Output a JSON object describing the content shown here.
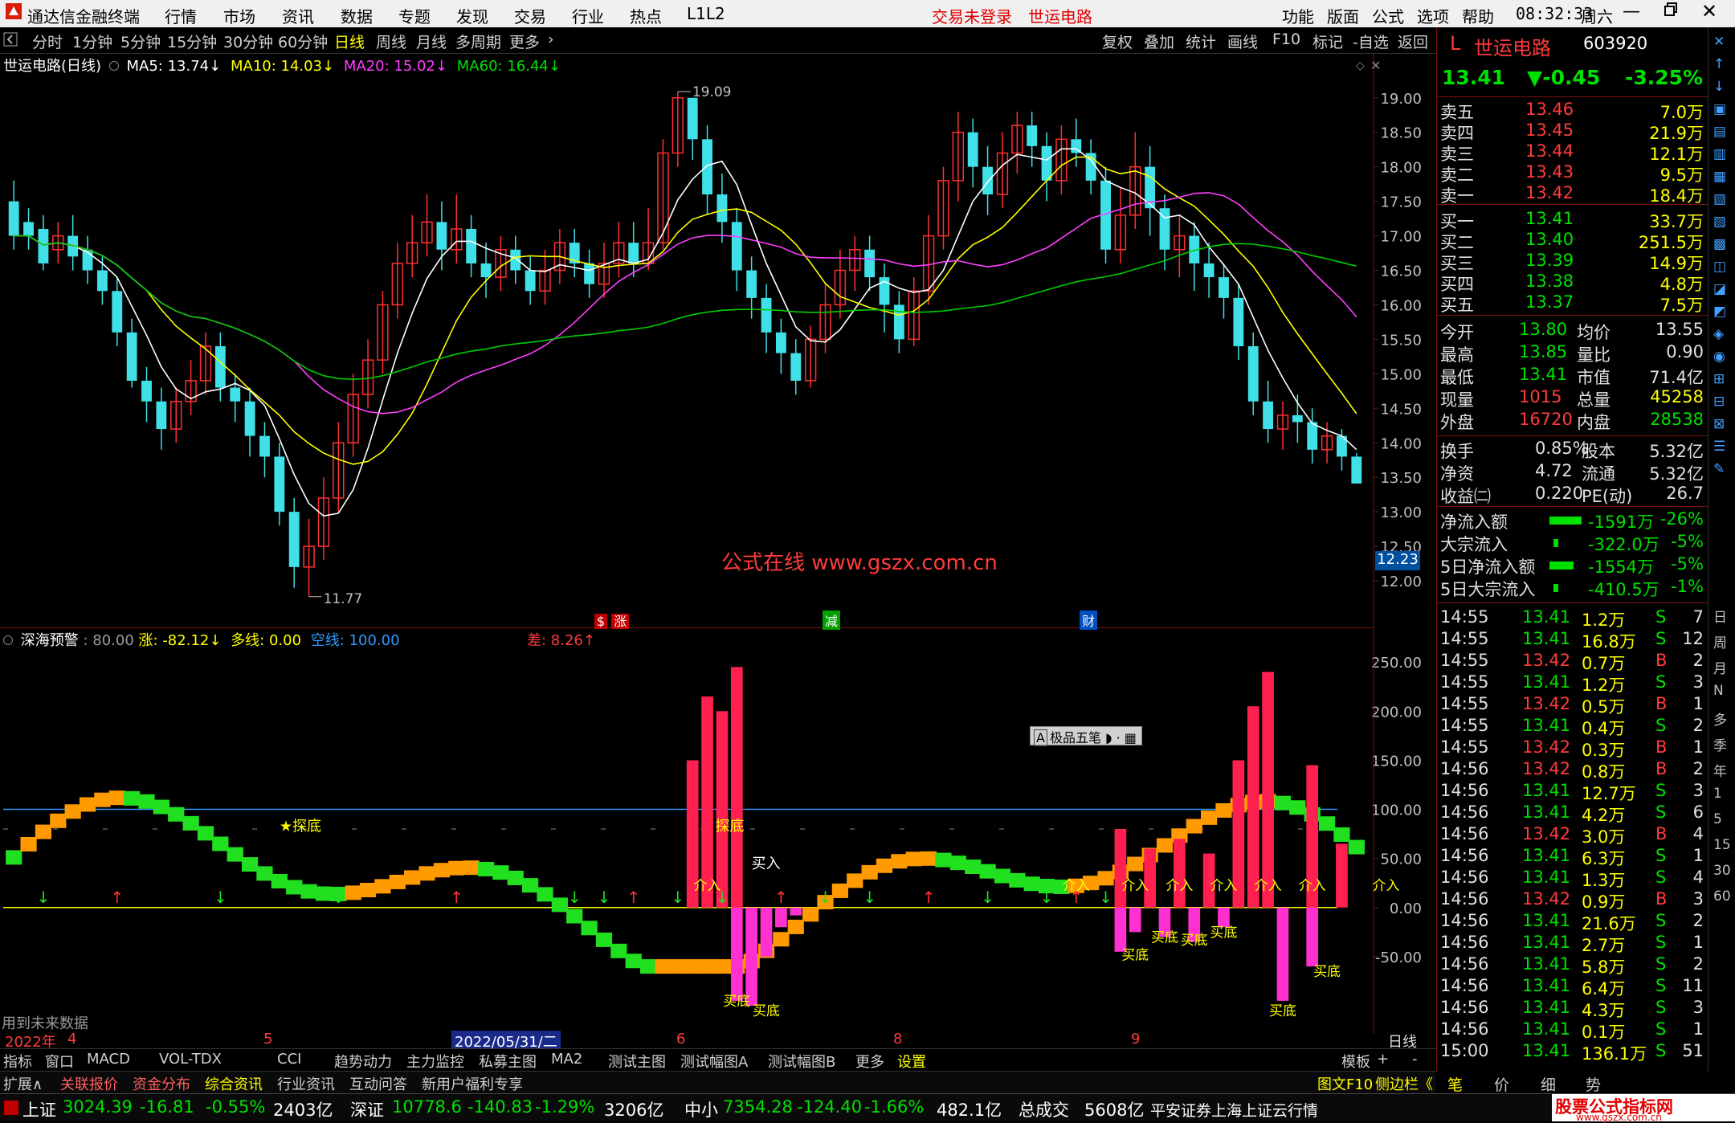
{
  "titlebar": {
    "app_name": "通达信金融终端",
    "menus": [
      "行情",
      "市场",
      "资讯",
      "数据",
      "专题",
      "发现",
      "交易",
      "行业",
      "热点",
      "L1L2"
    ],
    "login_status": "交易未登录",
    "stock_name": "世运电路",
    "right_menus": [
      "功能",
      "版面",
      "公式",
      "选项",
      "帮助"
    ],
    "time": "08:32:33",
    "weekday": "周六"
  },
  "toolbar": {
    "periods": [
      "分时",
      "1分钟",
      "5分钟",
      "15分钟",
      "30分钟",
      "60分钟",
      "日线",
      "周线",
      "月线",
      "多周期",
      "更多"
    ],
    "active_period": "日线",
    "tools": [
      "复权",
      "叠加",
      "统计",
      "画线",
      "F10",
      "标记",
      "-自选",
      "返回"
    ]
  },
  "main_chart": {
    "title": "世运电路(日线)",
    "ma5_label": "MA5: 13.74",
    "ma10_label": "MA10: 14.03",
    "ma20_label": "MA20: 15.02",
    "ma60_label": "MA60: 16.44",
    "high_marker": "19.09",
    "low_marker": "11.77",
    "current_price_tag": "12.23",
    "watermark": "公式在线  www.gszx.com.cn",
    "event_markers": [
      "涨",
      "减",
      "财"
    ]
  },
  "sub_chart": {
    "title": "深海预警",
    "param": ": 80.00",
    "zhang_label": "涨: -82.12",
    "duo_label": "多线: 0.00",
    "kong_label": "空线: 100.00",
    "cha_label": "差: 8.26",
    "note": "用到未来数据",
    "floating_toolbar": "极品五笔",
    "labels": [
      "★探底",
      "探底",
      "买入",
      "介入",
      "买底"
    ]
  },
  "chart_data": [
    {
      "type": "candlestick",
      "title": "世运电路(日线)",
      "yrange": [
        11.5,
        19.3
      ],
      "yticks": [
        19.0,
        18.5,
        18.0,
        17.5,
        17.0,
        16.5,
        16.0,
        15.5,
        15.0,
        14.5,
        14.0,
        13.5,
        13.0,
        12.5,
        12.0
      ],
      "series": [
        {
          "name": "MA5",
          "color": "#ffffff",
          "last": 13.74
        },
        {
          "name": "MA10",
          "color": "#ffff00",
          "last": 14.03
        },
        {
          "name": "MA20",
          "color": "#ff40ff",
          "last": 15.02
        },
        {
          "name": "MA60",
          "color": "#00cc00",
          "last": 16.44
        }
      ],
      "x_labels": [
        "2022年",
        "4",
        "5",
        "2022/05/31/二",
        "6",
        "8",
        "9",
        "日线"
      ],
      "candles": [
        [
          17.5,
          17.0,
          17.8,
          16.8
        ],
        [
          17.2,
          17.0,
          17.4,
          16.8
        ],
        [
          17.1,
          16.6,
          17.3,
          16.5
        ],
        [
          16.8,
          17.0,
          17.2,
          16.6
        ],
        [
          17.0,
          16.7,
          17.3,
          16.5
        ],
        [
          16.8,
          16.5,
          17.0,
          16.3
        ],
        [
          16.5,
          16.2,
          16.7,
          16.0
        ],
        [
          16.2,
          15.6,
          16.4,
          15.4
        ],
        [
          15.6,
          14.9,
          15.8,
          14.8
        ],
        [
          14.9,
          14.6,
          15.1,
          14.3
        ],
        [
          14.6,
          14.2,
          14.8,
          13.9
        ],
        [
          14.2,
          14.6,
          14.8,
          14.0
        ],
        [
          14.6,
          14.9,
          15.2,
          14.4
        ],
        [
          14.9,
          15.4,
          15.6,
          14.7
        ],
        [
          15.4,
          14.8,
          15.6,
          14.6
        ],
        [
          14.8,
          14.6,
          15.0,
          14.3
        ],
        [
          14.6,
          14.1,
          14.8,
          13.8
        ],
        [
          14.1,
          13.8,
          14.3,
          13.5
        ],
        [
          13.8,
          13.0,
          14.0,
          12.8
        ],
        [
          13.0,
          12.2,
          13.2,
          11.9
        ],
        [
          12.2,
          12.5,
          12.9,
          11.77
        ],
        [
          12.5,
          13.2,
          13.5,
          12.3
        ],
        [
          13.2,
          14.0,
          14.3,
          13.0
        ],
        [
          14.0,
          14.7,
          15.0,
          13.8
        ],
        [
          14.7,
          15.2,
          15.5,
          14.5
        ],
        [
          15.2,
          16.0,
          16.2,
          15.0
        ],
        [
          16.0,
          16.6,
          16.9,
          15.8
        ],
        [
          16.6,
          16.9,
          17.3,
          16.4
        ],
        [
          16.9,
          17.2,
          17.6,
          16.7
        ],
        [
          17.2,
          16.8,
          17.5,
          16.5
        ],
        [
          16.8,
          17.1,
          17.6,
          16.6
        ],
        [
          17.1,
          16.6,
          17.3,
          16.4
        ],
        [
          16.6,
          16.4,
          16.9,
          16.1
        ],
        [
          16.4,
          16.8,
          17.0,
          16.2
        ],
        [
          16.8,
          16.5,
          17.0,
          16.3
        ],
        [
          16.5,
          16.2,
          16.7,
          16.0
        ],
        [
          16.2,
          16.5,
          16.8,
          16.0
        ],
        [
          16.5,
          16.9,
          17.1,
          16.3
        ],
        [
          16.9,
          16.6,
          17.1,
          16.4
        ],
        [
          16.6,
          16.3,
          16.8,
          16.1
        ],
        [
          16.3,
          16.6,
          16.9,
          16.1
        ],
        [
          16.6,
          16.9,
          17.2,
          16.4
        ],
        [
          16.9,
          16.6,
          17.2,
          16.4
        ],
        [
          16.6,
          16.9,
          17.4,
          16.5
        ],
        [
          16.9,
          18.2,
          18.4,
          16.8
        ],
        [
          18.2,
          19.0,
          19.09,
          18.0
        ],
        [
          19.0,
          18.4,
          19.0,
          18.1
        ],
        [
          18.4,
          17.6,
          18.6,
          17.3
        ],
        [
          17.6,
          17.2,
          17.9,
          16.9
        ],
        [
          17.2,
          16.5,
          17.4,
          16.2
        ],
        [
          16.5,
          16.1,
          16.7,
          15.8
        ],
        [
          16.1,
          15.6,
          16.3,
          15.3
        ],
        [
          15.6,
          15.3,
          15.8,
          15.0
        ],
        [
          15.3,
          14.9,
          15.5,
          14.7
        ],
        [
          14.9,
          15.5,
          15.7,
          14.8
        ],
        [
          15.5,
          16.0,
          16.3,
          15.3
        ],
        [
          16.0,
          16.5,
          16.8,
          15.8
        ],
        [
          16.5,
          16.8,
          17.0,
          16.2
        ],
        [
          16.8,
          16.4,
          17.0,
          16.2
        ],
        [
          16.4,
          16.0,
          16.6,
          15.6
        ],
        [
          16.0,
          15.5,
          16.2,
          15.3
        ],
        [
          15.5,
          16.2,
          16.4,
          15.4
        ],
        [
          16.2,
          17.0,
          17.3,
          16.0
        ],
        [
          17.0,
          17.8,
          18.0,
          16.8
        ],
        [
          17.8,
          18.5,
          18.8,
          17.5
        ],
        [
          18.5,
          18.0,
          18.7,
          17.7
        ],
        [
          18.0,
          17.6,
          18.3,
          17.3
        ],
        [
          17.6,
          18.2,
          18.5,
          17.4
        ],
        [
          18.2,
          18.6,
          18.8,
          17.9
        ],
        [
          18.6,
          18.3,
          18.8,
          18.0
        ],
        [
          18.3,
          17.8,
          18.5,
          17.5
        ],
        [
          17.8,
          18.4,
          18.6,
          17.6
        ],
        [
          18.4,
          18.2,
          18.7,
          18.0
        ],
        [
          18.2,
          17.8,
          18.4,
          17.6
        ],
        [
          17.8,
          16.8,
          18.0,
          16.6
        ],
        [
          16.8,
          17.3,
          17.7,
          16.6
        ],
        [
          17.3,
          18.0,
          18.5,
          17.1
        ],
        [
          18.0,
          17.4,
          18.3,
          17.0
        ],
        [
          17.4,
          16.8,
          17.6,
          16.5
        ],
        [
          16.8,
          17.0,
          17.3,
          16.4
        ],
        [
          17.0,
          16.6,
          17.2,
          16.2
        ],
        [
          16.6,
          16.4,
          16.9,
          16.1
        ],
        [
          16.4,
          16.1,
          16.6,
          15.8
        ],
        [
          16.1,
          15.4,
          16.3,
          15.2
        ],
        [
          15.4,
          14.6,
          15.6,
          14.4
        ],
        [
          14.6,
          14.2,
          14.9,
          14.0
        ],
        [
          14.2,
          14.4,
          14.6,
          13.9
        ],
        [
          14.4,
          14.3,
          14.7,
          14.0
        ],
        [
          14.3,
          13.9,
          14.5,
          13.7
        ],
        [
          13.9,
          14.1,
          14.3,
          13.7
        ],
        [
          14.1,
          13.8,
          14.2,
          13.6
        ],
        [
          13.8,
          13.41,
          13.85,
          13.41
        ]
      ]
    },
    {
      "type": "bar",
      "title": "深海预警",
      "yrange": [
        -100,
        260
      ],
      "yticks": [
        250.0,
        200.0,
        150.0,
        100.0,
        50.0,
        0.0,
        -50.0
      ],
      "series": [
        {
          "name": "涨",
          "color": "#ff3050",
          "last": -82.12
        },
        {
          "name": "多线",
          "color": "#ffff00",
          "last": 0.0
        },
        {
          "name": "空线",
          "color": "#3399ff",
          "last": 100.0
        },
        {
          "name": "差",
          "color": "#ff3050",
          "last": 8.26
        }
      ],
      "bars": [
        {
          "i": 46,
          "v": 150
        },
        {
          "i": 47,
          "v": 215
        },
        {
          "i": 48,
          "v": 200
        },
        {
          "i": 49,
          "v": 245
        },
        {
          "i": 75,
          "v": 80
        },
        {
          "i": 77,
          "v": 60
        },
        {
          "i": 79,
          "v": 70
        },
        {
          "i": 81,
          "v": 55
        },
        {
          "i": 83,
          "v": 150
        },
        {
          "i": 84,
          "v": 205
        },
        {
          "i": 85,
          "v": 240
        },
        {
          "i": 88,
          "v": 145
        },
        {
          "i": 90,
          "v": 65
        }
      ],
      "neg_bars": [
        {
          "i": 49,
          "v": -95
        },
        {
          "i": 50,
          "v": -100
        },
        {
          "i": 51,
          "v": -50
        },
        {
          "i": 52,
          "v": -20
        },
        {
          "i": 53,
          "v": -8
        },
        {
          "i": 75,
          "v": -45
        },
        {
          "i": 76,
          "v": -25
        },
        {
          "i": 78,
          "v": -30
        },
        {
          "i": 80,
          "v": -35
        },
        {
          "i": 82,
          "v": -20
        },
        {
          "i": 86,
          "v": -95
        },
        {
          "i": 88,
          "v": -60
        }
      ]
    }
  ],
  "quote": {
    "market_tag": "L",
    "name": "世运电路",
    "code": "603920",
    "price": "13.41",
    "change": "▼-0.45",
    "pct": "-3.25%",
    "asks": [
      {
        "label": "卖五",
        "price": "13.46",
        "vol": "7.0万"
      },
      {
        "label": "卖四",
        "price": "13.45",
        "vol": "21.9万"
      },
      {
        "label": "卖三",
        "price": "13.44",
        "vol": "12.1万"
      },
      {
        "label": "卖二",
        "price": "13.43",
        "vol": "9.5万"
      },
      {
        "label": "卖一",
        "price": "13.42",
        "vol": "18.4万"
      }
    ],
    "bids": [
      {
        "label": "买一",
        "price": "13.41",
        "vol": "33.7万"
      },
      {
        "label": "买二",
        "price": "13.40",
        "vol": "251.5万"
      },
      {
        "label": "买三",
        "price": "13.39",
        "vol": "14.9万"
      },
      {
        "label": "买四",
        "price": "13.38",
        "vol": "4.8万"
      },
      {
        "label": "买五",
        "price": "13.37",
        "vol": "7.5万"
      }
    ],
    "stats": [
      {
        "k1": "今开",
        "v1": "13.80",
        "k2": "均价",
        "v2": "13.55"
      },
      {
        "k1": "最高",
        "v1": "13.85",
        "k2": "量比",
        "v2": "0.90"
      },
      {
        "k1": "最低",
        "v1": "13.41",
        "k2": "市值",
        "v2": "71.4亿"
      },
      {
        "k1": "现量",
        "v1": "1015",
        "k2": "总量",
        "v2": "45258"
      },
      {
        "k1": "外盘",
        "v1": "16720",
        "k2": "内盘",
        "v2": "28538"
      }
    ],
    "stats2": [
      {
        "k1": "换手",
        "v1": "0.85%",
        "k2": "股本",
        "v2": "5.32亿"
      },
      {
        "k1": "净资",
        "v1": "4.72",
        "k2": "流通",
        "v2": "5.32亿"
      },
      {
        "k1": "收益㈡",
        "v1": "0.220",
        "k2": "PE(动)",
        "v2": "26.7"
      }
    ],
    "flows": [
      {
        "label": "净流入额",
        "value": "-1591万",
        "pct": "-26%"
      },
      {
        "label": "大宗流入",
        "value": "-322.0万",
        "pct": "-5%"
      },
      {
        "label": "5日净流入额",
        "value": "-1554万",
        "pct": "-5%"
      },
      {
        "label": "5日大宗流入",
        "value": "-410.5万",
        "pct": "-1%"
      }
    ],
    "ticks": [
      {
        "t": "14:55",
        "p": "13.41",
        "v": "1.2万",
        "s": "S",
        "n": "7"
      },
      {
        "t": "14:55",
        "p": "13.41",
        "v": "16.8万",
        "s": "S",
        "n": "12"
      },
      {
        "t": "14:55",
        "p": "13.42",
        "v": "0.7万",
        "s": "B",
        "n": "2"
      },
      {
        "t": "14:55",
        "p": "13.41",
        "v": "1.2万",
        "s": "S",
        "n": "3"
      },
      {
        "t": "14:55",
        "p": "13.42",
        "v": "0.5万",
        "s": "B",
        "n": "1"
      },
      {
        "t": "14:55",
        "p": "13.41",
        "v": "0.4万",
        "s": "S",
        "n": "2"
      },
      {
        "t": "14:55",
        "p": "13.42",
        "v": "0.3万",
        "s": "B",
        "n": "1"
      },
      {
        "t": "14:56",
        "p": "13.42",
        "v": "0.8万",
        "s": "B",
        "n": "2"
      },
      {
        "t": "14:56",
        "p": "13.41",
        "v": "12.7万",
        "s": "S",
        "n": "3"
      },
      {
        "t": "14:56",
        "p": "13.41",
        "v": "4.2万",
        "s": "S",
        "n": "6"
      },
      {
        "t": "14:56",
        "p": "13.42",
        "v": "3.0万",
        "s": "B",
        "n": "4"
      },
      {
        "t": "14:56",
        "p": "13.41",
        "v": "6.3万",
        "s": "S",
        "n": "1"
      },
      {
        "t": "14:56",
        "p": "13.41",
        "v": "1.3万",
        "s": "S",
        "n": "4"
      },
      {
        "t": "14:56",
        "p": "13.42",
        "v": "0.9万",
        "s": "B",
        "n": "3"
      },
      {
        "t": "14:56",
        "p": "13.41",
        "v": "21.6万",
        "s": "S",
        "n": "2"
      },
      {
        "t": "14:56",
        "p": "13.41",
        "v": "2.7万",
        "s": "S",
        "n": "1"
      },
      {
        "t": "14:56",
        "p": "13.41",
        "v": "5.8万",
        "s": "S",
        "n": "2"
      },
      {
        "t": "14:56",
        "p": "13.41",
        "v": "6.4万",
        "s": "S",
        "n": "11"
      },
      {
        "t": "14:56",
        "p": "13.41",
        "v": "4.3万",
        "s": "S",
        "n": "3"
      },
      {
        "t": "14:56",
        "p": "13.41",
        "v": "0.1万",
        "s": "S",
        "n": "1"
      },
      {
        "t": "15:00",
        "p": "13.41",
        "v": "136.1万",
        "s": "S",
        "n": "51"
      }
    ],
    "bottom_tabs": [
      "笔",
      "价",
      "细",
      "势"
    ]
  },
  "vtabs": [
    "日",
    "周",
    "月",
    "N",
    "多",
    "季",
    "年",
    "1",
    "5",
    "15",
    "30",
    "60"
  ],
  "date_axis": [
    "2022年",
    "4",
    "5",
    "2022/05/31/二",
    "6",
    "8",
    "9",
    "日线"
  ],
  "indicator_tabs": [
    "指标",
    "窗口",
    "MACD",
    "VOL-TDX",
    "CCI",
    "趋势动力",
    "主力监控",
    "私募主图",
    "MA2",
    "测试主图",
    "测试幅图A",
    "测试幅图B",
    "更多",
    "设置"
  ],
  "indicator_right": [
    "模板",
    "+",
    "-"
  ],
  "link_tabs": [
    "扩展∧",
    "关联报价",
    "资金分布",
    "综合资讯",
    "行业资讯",
    "互动问答",
    "新用户福利专享"
  ],
  "link_right": [
    "图文F10",
    "侧边栏《"
  ],
  "statusbar": {
    "sh_label": "上证",
    "sh_val": "3024.39",
    "sh_chg": "-16.81",
    "sh_pct": "-0.55%",
    "sh_amt": "2403亿",
    "sz_label": "深证",
    "sz_val": "10778.6",
    "sz_chg": "-140.83",
    "sz_pct": "-1.29%",
    "sz_amt": "3206亿",
    "zx_label": "中小",
    "zx_val": "7354.28",
    "zx_chg": "-124.40",
    "zx_pct": "-1.66%",
    "zx_amt": "482.1亿",
    "total_label": "总成交",
    "total_val": "5608亿",
    "broker": "平安证券上海上证云行情",
    "site_logo": "股票公式指标网",
    "site_url": "www.gszx.com.cn"
  }
}
